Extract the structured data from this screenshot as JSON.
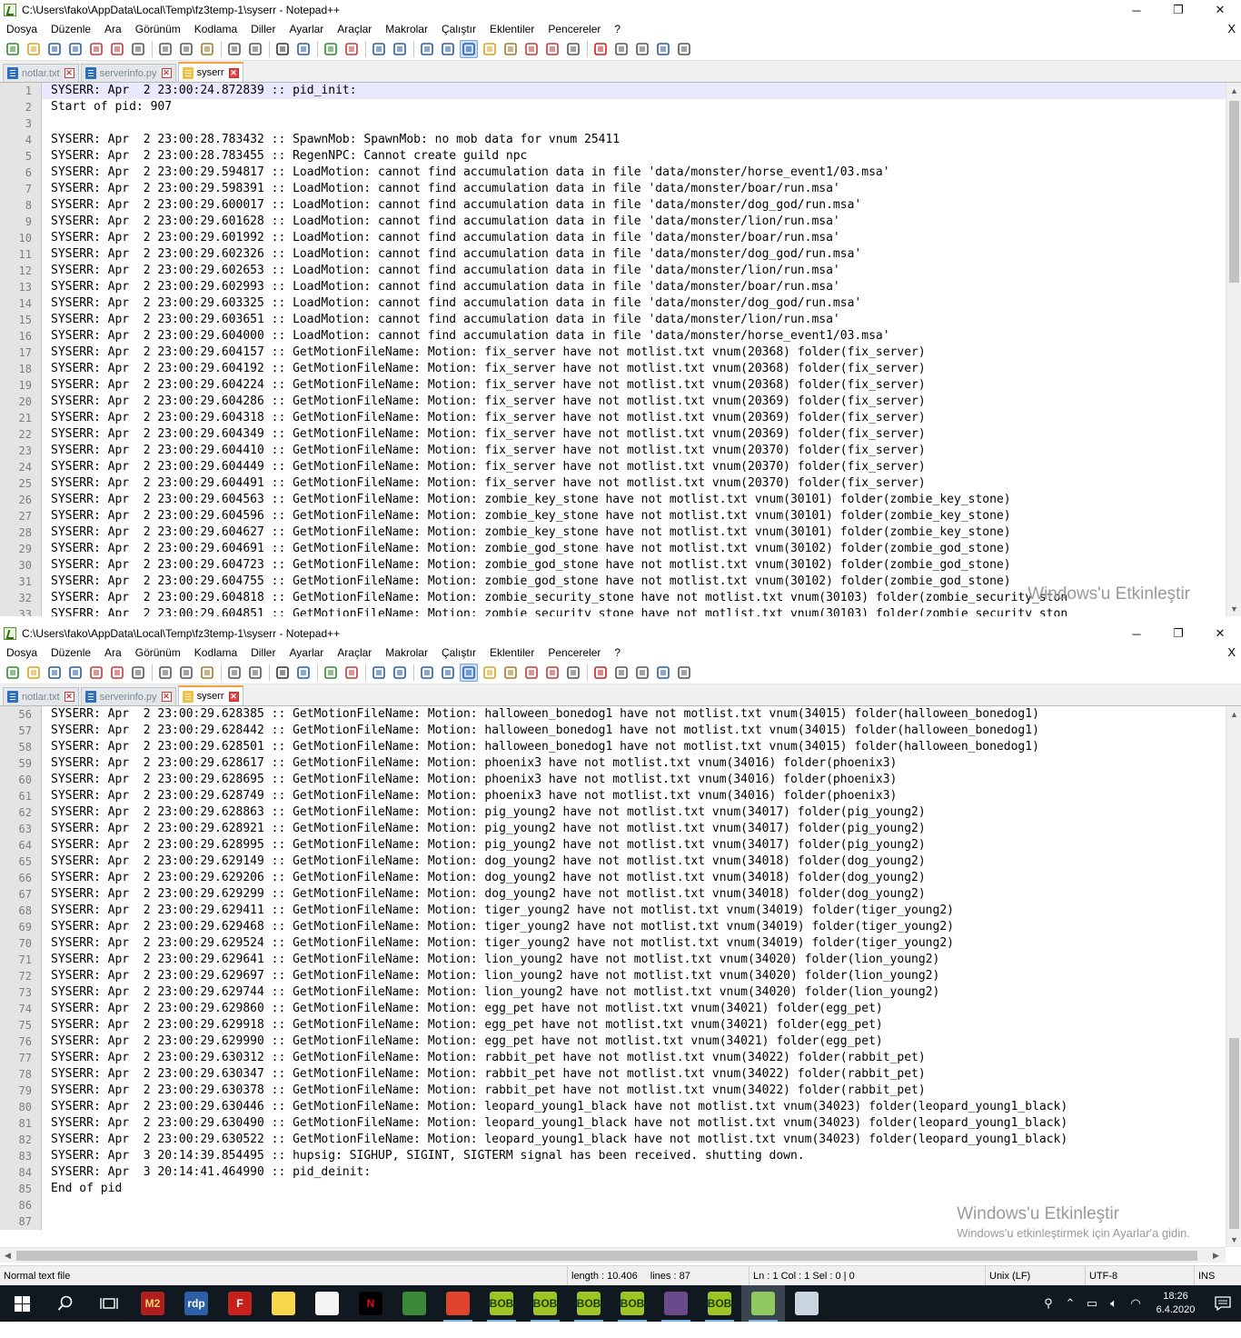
{
  "window_top": {
    "title": "C:\\Users\\fako\\AppData\\Local\\Temp\\fz3temp-1\\syserr - Notepad++",
    "first_line": 1,
    "lines": [
      "SYSERR: Apr  2 23:00:24.872839 :: pid_init: ",
      "Start of pid: 907",
      "",
      "SYSERR: Apr  2 23:00:28.783432 :: SpawnMob: SpawnMob: no mob data for vnum 25411",
      "SYSERR: Apr  2 23:00:28.783455 :: RegenNPC: Cannot create guild npc",
      "SYSERR: Apr  2 23:00:29.594817 :: LoadMotion: cannot find accumulation data in file 'data/monster/horse_event1/03.msa'",
      "SYSERR: Apr  2 23:00:29.598391 :: LoadMotion: cannot find accumulation data in file 'data/monster/boar/run.msa'",
      "SYSERR: Apr  2 23:00:29.600017 :: LoadMotion: cannot find accumulation data in file 'data/monster/dog_god/run.msa'",
      "SYSERR: Apr  2 23:00:29.601628 :: LoadMotion: cannot find accumulation data in file 'data/monster/lion/run.msa'",
      "SYSERR: Apr  2 23:00:29.601992 :: LoadMotion: cannot find accumulation data in file 'data/monster/boar/run.msa'",
      "SYSERR: Apr  2 23:00:29.602326 :: LoadMotion: cannot find accumulation data in file 'data/monster/dog_god/run.msa'",
      "SYSERR: Apr  2 23:00:29.602653 :: LoadMotion: cannot find accumulation data in file 'data/monster/lion/run.msa'",
      "SYSERR: Apr  2 23:00:29.602993 :: LoadMotion: cannot find accumulation data in file 'data/monster/boar/run.msa'",
      "SYSERR: Apr  2 23:00:29.603325 :: LoadMotion: cannot find accumulation data in file 'data/monster/dog_god/run.msa'",
      "SYSERR: Apr  2 23:00:29.603651 :: LoadMotion: cannot find accumulation data in file 'data/monster/lion/run.msa'",
      "SYSERR: Apr  2 23:00:29.604000 :: LoadMotion: cannot find accumulation data in file 'data/monster/horse_event1/03.msa'",
      "SYSERR: Apr  2 23:00:29.604157 :: GetMotionFileName: Motion: fix_server have not motlist.txt vnum(20368) folder(fix_server)",
      "SYSERR: Apr  2 23:00:29.604192 :: GetMotionFileName: Motion: fix_server have not motlist.txt vnum(20368) folder(fix_server)",
      "SYSERR: Apr  2 23:00:29.604224 :: GetMotionFileName: Motion: fix_server have not motlist.txt vnum(20368) folder(fix_server)",
      "SYSERR: Apr  2 23:00:29.604286 :: GetMotionFileName: Motion: fix_server have not motlist.txt vnum(20369) folder(fix_server)",
      "SYSERR: Apr  2 23:00:29.604318 :: GetMotionFileName: Motion: fix_server have not motlist.txt vnum(20369) folder(fix_server)",
      "SYSERR: Apr  2 23:00:29.604349 :: GetMotionFileName: Motion: fix_server have not motlist.txt vnum(20369) folder(fix_server)",
      "SYSERR: Apr  2 23:00:29.604410 :: GetMotionFileName: Motion: fix_server have not motlist.txt vnum(20370) folder(fix_server)",
      "SYSERR: Apr  2 23:00:29.604449 :: GetMotionFileName: Motion: fix_server have not motlist.txt vnum(20370) folder(fix_server)",
      "SYSERR: Apr  2 23:00:29.604491 :: GetMotionFileName: Motion: fix_server have not motlist.txt vnum(20370) folder(fix_server)",
      "SYSERR: Apr  2 23:00:29.604563 :: GetMotionFileName: Motion: zombie_key_stone have not motlist.txt vnum(30101) folder(zombie_key_stone)",
      "SYSERR: Apr  2 23:00:29.604596 :: GetMotionFileName: Motion: zombie_key_stone have not motlist.txt vnum(30101) folder(zombie_key_stone)",
      "SYSERR: Apr  2 23:00:29.604627 :: GetMotionFileName: Motion: zombie_key_stone have not motlist.txt vnum(30101) folder(zombie_key_stone)",
      "SYSERR: Apr  2 23:00:29.604691 :: GetMotionFileName: Motion: zombie_god_stone have not motlist.txt vnum(30102) folder(zombie_god_stone)",
      "SYSERR: Apr  2 23:00:29.604723 :: GetMotionFileName: Motion: zombie_god_stone have not motlist.txt vnum(30102) folder(zombie_god_stone)",
      "SYSERR: Apr  2 23:00:29.604755 :: GetMotionFileName: Motion: zombie_god_stone have not motlist.txt vnum(30102) folder(zombie_god_stone)",
      "SYSERR: Apr  2 23:00:29.604818 :: GetMotionFileName: Motion: zombie_security_stone have not motlist.txt vnum(30103) folder(zombie_security_ston",
      "SYSERR: Apr  2 23:00:29.604851 :: GetMotionFileName: Motion: zombie_security_stone have not motlist.txt vnum(30103) folder(zombie_security_ston"
    ],
    "watermark": "Windows'u Etkinleştir"
  },
  "window_bottom": {
    "title": "C:\\Users\\fako\\AppData\\Local\\Temp\\fz3temp-1\\syserr - Notepad++",
    "first_line": 56,
    "lines": [
      "SYSERR: Apr  2 23:00:29.628385 :: GetMotionFileName: Motion: halloween_bonedog1 have not motlist.txt vnum(34015) folder(halloween_bonedog1)",
      "SYSERR: Apr  2 23:00:29.628442 :: GetMotionFileName: Motion: halloween_bonedog1 have not motlist.txt vnum(34015) folder(halloween_bonedog1)",
      "SYSERR: Apr  2 23:00:29.628501 :: GetMotionFileName: Motion: halloween_bonedog1 have not motlist.txt vnum(34015) folder(halloween_bonedog1)",
      "SYSERR: Apr  2 23:00:29.628617 :: GetMotionFileName: Motion: phoenix3 have not motlist.txt vnum(34016) folder(phoenix3)",
      "SYSERR: Apr  2 23:00:29.628695 :: GetMotionFileName: Motion: phoenix3 have not motlist.txt vnum(34016) folder(phoenix3)",
      "SYSERR: Apr  2 23:00:29.628749 :: GetMotionFileName: Motion: phoenix3 have not motlist.txt vnum(34016) folder(phoenix3)",
      "SYSERR: Apr  2 23:00:29.628863 :: GetMotionFileName: Motion: pig_young2 have not motlist.txt vnum(34017) folder(pig_young2)",
      "SYSERR: Apr  2 23:00:29.628921 :: GetMotionFileName: Motion: pig_young2 have not motlist.txt vnum(34017) folder(pig_young2)",
      "SYSERR: Apr  2 23:00:29.628995 :: GetMotionFileName: Motion: pig_young2 have not motlist.txt vnum(34017) folder(pig_young2)",
      "SYSERR: Apr  2 23:00:29.629149 :: GetMotionFileName: Motion: dog_young2 have not motlist.txt vnum(34018) folder(dog_young2)",
      "SYSERR: Apr  2 23:00:29.629206 :: GetMotionFileName: Motion: dog_young2 have not motlist.txt vnum(34018) folder(dog_young2)",
      "SYSERR: Apr  2 23:00:29.629299 :: GetMotionFileName: Motion: dog_young2 have not motlist.txt vnum(34018) folder(dog_young2)",
      "SYSERR: Apr  2 23:00:29.629411 :: GetMotionFileName: Motion: tiger_young2 have not motlist.txt vnum(34019) folder(tiger_young2)",
      "SYSERR: Apr  2 23:00:29.629468 :: GetMotionFileName: Motion: tiger_young2 have not motlist.txt vnum(34019) folder(tiger_young2)",
      "SYSERR: Apr  2 23:00:29.629524 :: GetMotionFileName: Motion: tiger_young2 have not motlist.txt vnum(34019) folder(tiger_young2)",
      "SYSERR: Apr  2 23:00:29.629641 :: GetMotionFileName: Motion: lion_young2 have not motlist.txt vnum(34020) folder(lion_young2)",
      "SYSERR: Apr  2 23:00:29.629697 :: GetMotionFileName: Motion: lion_young2 have not motlist.txt vnum(34020) folder(lion_young2)",
      "SYSERR: Apr  2 23:00:29.629744 :: GetMotionFileName: Motion: lion_young2 have not motlist.txt vnum(34020) folder(lion_young2)",
      "SYSERR: Apr  2 23:00:29.629860 :: GetMotionFileName: Motion: egg_pet have not motlist.txt vnum(34021) folder(egg_pet)",
      "SYSERR: Apr  2 23:00:29.629918 :: GetMotionFileName: Motion: egg_pet have not motlist.txt vnum(34021) folder(egg_pet)",
      "SYSERR: Apr  2 23:00:29.629990 :: GetMotionFileName: Motion: egg_pet have not motlist.txt vnum(34021) folder(egg_pet)",
      "SYSERR: Apr  2 23:00:29.630312 :: GetMotionFileName: Motion: rabbit_pet have not motlist.txt vnum(34022) folder(rabbit_pet)",
      "SYSERR: Apr  2 23:00:29.630347 :: GetMotionFileName: Motion: rabbit_pet have not motlist.txt vnum(34022) folder(rabbit_pet)",
      "SYSERR: Apr  2 23:00:29.630378 :: GetMotionFileName: Motion: rabbit_pet have not motlist.txt vnum(34022) folder(rabbit_pet)",
      "SYSERR: Apr  2 23:00:29.630446 :: GetMotionFileName: Motion: leopard_young1_black have not motlist.txt vnum(34023) folder(leopard_young1_black)",
      "SYSERR: Apr  2 23:00:29.630490 :: GetMotionFileName: Motion: leopard_young1_black have not motlist.txt vnum(34023) folder(leopard_young1_black)",
      "SYSERR: Apr  2 23:00:29.630522 :: GetMotionFileName: Motion: leopard_young1_black have not motlist.txt vnum(34023) folder(leopard_young1_black)",
      "SYSERR: Apr  3 20:14:39.854495 :: hupsig: SIGHUP, SIGINT, SIGTERM signal has been received. shutting down.",
      "SYSERR: Apr  3 20:14:41.464990 :: pid_deinit: ",
      "End of pid",
      "",
      ""
    ],
    "watermark": "Windows'u Etkinleştir",
    "watermark_sub": "Windows'u etkinleştirmek için Ayarlar'a gidin."
  },
  "menu": [
    "Dosya",
    "Düzenle",
    "Ara",
    "Görünüm",
    "Kodlama",
    "Diller",
    "Ayarlar",
    "Araçlar",
    "Makrolar",
    "Çalıştır",
    "Eklentiler",
    "Pencereler",
    "?"
  ],
  "menu_close": "X",
  "tabs": [
    {
      "label": "notlar.txt",
      "active": false
    },
    {
      "label": "serverinfo.py",
      "active": false
    },
    {
      "label": "syserr",
      "active": true
    }
  ],
  "window_controls": {
    "minimize": "─",
    "restore": "❐",
    "close": "✕"
  },
  "statusbar": {
    "file_type": "Normal text file",
    "length": "length : 10.406",
    "lines": "lines : 87",
    "position": "Ln : 1    Col : 1    Sel : 0 | 0",
    "eol": "Unix (LF)",
    "encoding": "UTF-8",
    "mode": "INS"
  },
  "taskbar": {
    "apps": [
      {
        "name": "M2",
        "color": "#b01e1e",
        "fg": "#f2d16b",
        "running": false
      },
      {
        "name": "rdp",
        "color": "#2d5fa8",
        "fg": "#fff",
        "running": false
      },
      {
        "name": "F",
        "color": "#c8201c",
        "fg": "#fff",
        "running": false
      },
      {
        "name": "",
        "color": "#f6d64a",
        "fg": "#000",
        "running": false
      },
      {
        "name": "",
        "color": "#f5f5f5",
        "fg": "#000",
        "running": false
      },
      {
        "name": "N",
        "color": "#000",
        "fg": "#e50914",
        "running": false
      },
      {
        "name": "",
        "color": "#3a8a3a",
        "fg": "#fff",
        "running": false
      },
      {
        "name": "",
        "color": "#e0442f",
        "fg": "#fff",
        "running": true
      },
      {
        "name": "BOB",
        "color": "#9cc425",
        "fg": "#1f3d00",
        "running": true
      },
      {
        "name": "BOB",
        "color": "#9cc425",
        "fg": "#1f3d00",
        "running": true
      },
      {
        "name": "BOB",
        "color": "#9cc425",
        "fg": "#1f3d00",
        "running": true
      },
      {
        "name": "BOB",
        "color": "#9cc425",
        "fg": "#1f3d00",
        "running": true
      },
      {
        "name": "",
        "color": "#6a4a8a",
        "fg": "#fff",
        "running": true
      },
      {
        "name": "BOB",
        "color": "#9cc425",
        "fg": "#1f3d00",
        "running": true
      },
      {
        "name": "",
        "color": "#90c860",
        "fg": "#1f3d00",
        "running": true
      },
      {
        "name": "",
        "color": "#c9d6e2",
        "fg": "#1a3a5a",
        "running": false
      }
    ],
    "time": "18:26",
    "date": "6.4.2020"
  }
}
